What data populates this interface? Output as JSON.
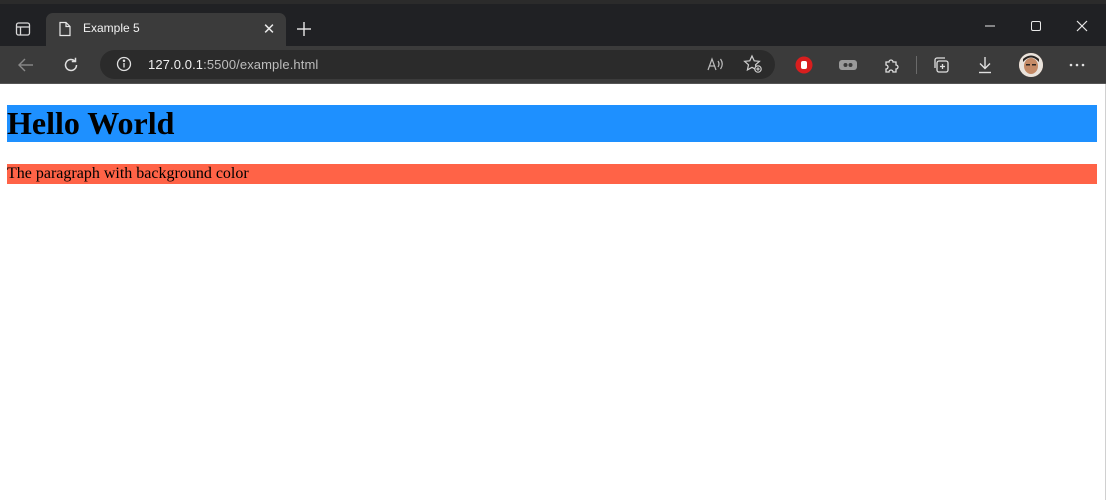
{
  "browser": {
    "tab": {
      "title": "Example 5"
    },
    "address": {
      "host": "127.0.0.1",
      "path": ":5500/example.html"
    },
    "icons": {
      "tab_actions": "tab-actions-icon",
      "page": "page-icon",
      "close_tab": "close-icon",
      "new_tab": "plus-icon",
      "back": "back-arrow-icon",
      "refresh": "refresh-icon",
      "site_info": "info-icon",
      "read_aloud": "read-aloud-icon",
      "favorite": "add-favorite-icon",
      "extension_red": "stop-hand-icon",
      "extension_gray": "extension-icon",
      "extensions": "puzzle-icon",
      "collections": "collections-icon",
      "downloads": "download-icon",
      "profile": "avatar",
      "more": "more-icon"
    }
  },
  "page": {
    "heading": "Hello World",
    "paragraph": "The paragraph with background color"
  },
  "colors": {
    "heading_bg": "#1e90ff",
    "paragraph_bg": "#ff6347",
    "browser_frame": "#202124",
    "toolbar": "#3b3b3b"
  }
}
